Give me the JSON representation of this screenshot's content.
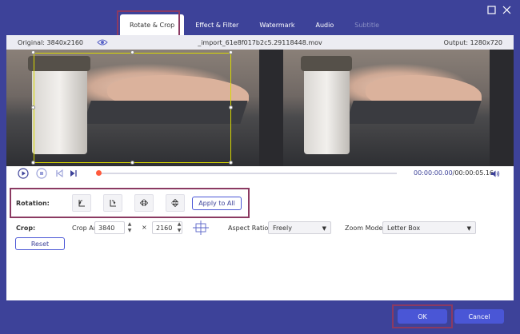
{
  "tabs": [
    {
      "label": "Rotate & Crop",
      "state": "active"
    },
    {
      "label": "Effect & Filter",
      "state": "normal"
    },
    {
      "label": "Watermark",
      "state": "normal"
    },
    {
      "label": "Audio",
      "state": "normal"
    },
    {
      "label": "Subtitle",
      "state": "disabled"
    }
  ],
  "info": {
    "original": "Original: 3840x2160",
    "filename": "_import_61e8f017b2c5.29118448.mov",
    "output": "Output: 1280x720"
  },
  "playback": {
    "current_time": "00:00:00.00",
    "total_time": "/00:00:05.16",
    "progress": 0.0
  },
  "rotation": {
    "label": "Rotation:",
    "apply_all_label": "Apply to All"
  },
  "crop": {
    "label": "Crop:",
    "area_label": "Crop Area:",
    "width": "3840",
    "times": "×",
    "height": "2160",
    "aspect_label": "Aspect Ratio:",
    "aspect_value": "Freely",
    "zoom_label": "Zoom Mode:",
    "zoom_value": "Letter Box",
    "reset_label": "Reset"
  },
  "footer": {
    "ok_label": "OK",
    "cancel_label": "Cancel"
  },
  "colors": {
    "chrome": "#3d4299",
    "accent": "#4a56d6",
    "highlight": "#8b3a62",
    "crop_frame": "#d8d800",
    "progress_dot": "#ff5a3c"
  }
}
